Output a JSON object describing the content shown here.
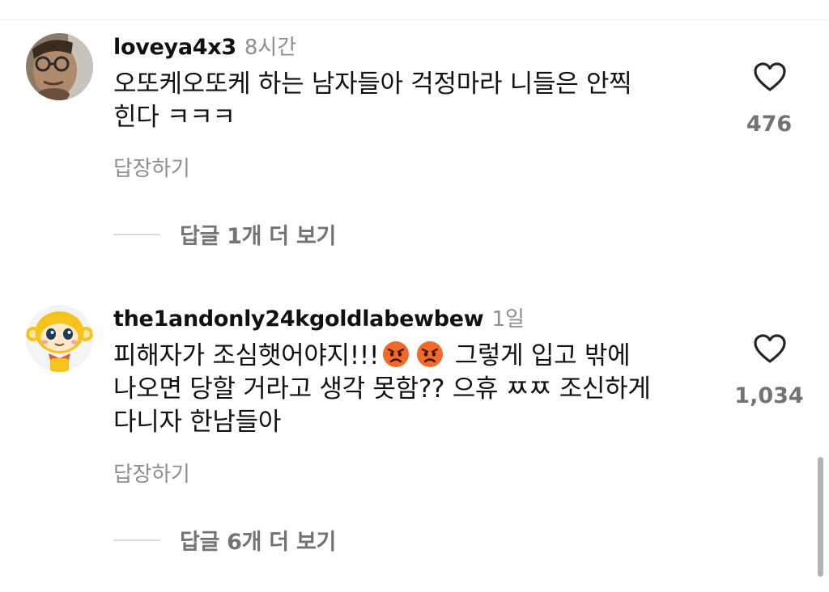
{
  "comments": [
    {
      "username": "loveya4x3",
      "time": "8시간",
      "text_lines": [
        "오또케오또케 하는 남자들아 걱정마라 니들은 안찍",
        "힌다 ㅋㅋㅋ"
      ],
      "likes": "476",
      "reply_label": "답장하기",
      "view_replies": "답글 1개 더 보기",
      "avatar_icon": "man-with-glasses-photo"
    },
    {
      "username": "the1andonly24kgoldlabewbew",
      "time": "1일",
      "text_line1_pre": "피해자가 조심햇어야지!!!",
      "text_line1_post": "그렇게 입고 밖에",
      "text_lines_rest": [
        "나오면 당할 거라고 생각 못함?? 으휴 ㅉㅉ 조신하게",
        "다니자 한남들아"
      ],
      "emoji": [
        "angry-face-emoji",
        "angry-face-emoji"
      ],
      "likes": "1,034",
      "reply_label": "답장하기",
      "view_replies": "답글 6개 더 보기",
      "avatar_icon": "yellow-monkey-cartoon"
    }
  ],
  "colors": {
    "text": "#111111",
    "muted": "#8e8e8e",
    "count": "#737373",
    "divider": "#dbdbdb",
    "emoji": "#f06a2b"
  }
}
